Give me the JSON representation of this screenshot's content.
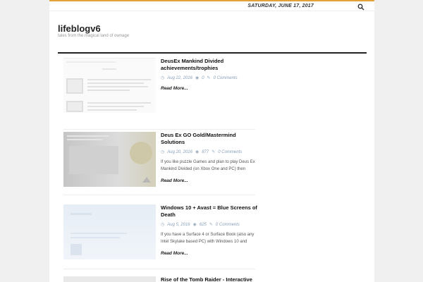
{
  "topbar": {
    "date": "SATURDAY, JUNE 17, 2017",
    "search_icon": "search-icon"
  },
  "site": {
    "title": "lifeblogv6",
    "tagline": "tales from the magical land of ownage"
  },
  "posts": [
    {
      "title": "DeusEx Mankind Divided achievements/trophies",
      "date": "Aug 22, 2016",
      "views": "0",
      "comments": "0 Comments",
      "excerpt": "",
      "more": "Read More..."
    },
    {
      "title": "Deus Ex GO Gold/Mastermind Solutions",
      "date": "Aug 20, 2016",
      "views": "877",
      "comments": "0 Comments",
      "excerpt": "If you like puzzle Games and plan to play Deus Ex Mankind Divided (on Xbox One and PC) then",
      "more": "Read More..."
    },
    {
      "title": "Windows 10 + Avast = Blue Screens of Death",
      "date": "Aug 5, 2016",
      "views": "625",
      "comments": "0 Comments",
      "excerpt": "If you have a Surface 4 or Surface Book (also any Intel Skylake based PC) with Windows 10 and",
      "more": "Read More..."
    },
    {
      "title": "Rise of the Tomb Raider - Interactive"
    }
  ],
  "colors": {
    "accent": "#e0a23a",
    "meta": "#8aa0b8"
  }
}
